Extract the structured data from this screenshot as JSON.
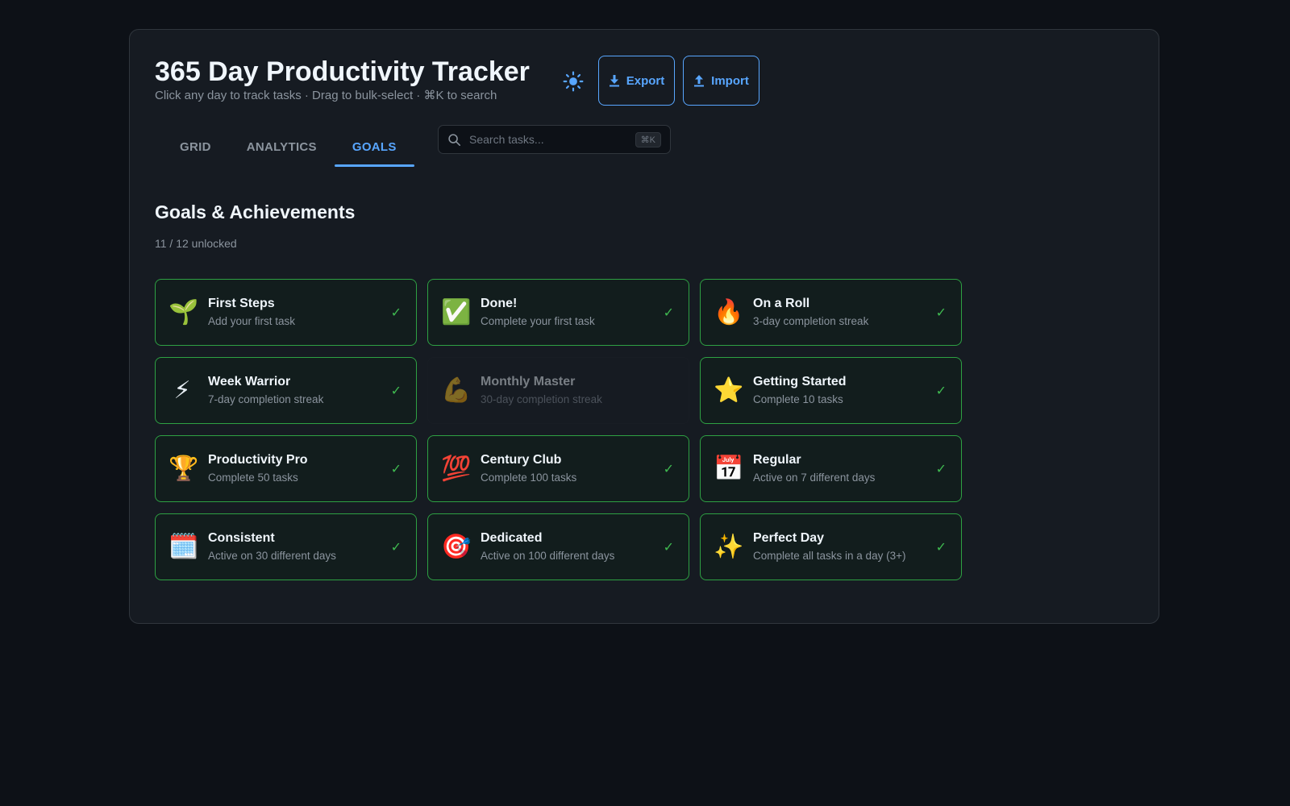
{
  "header": {
    "title": "365 Day Productivity Tracker",
    "subtitle": "Click any day to track tasks · Drag to bulk-select · ⌘K to search",
    "theme_icon": "sun-icon",
    "export_label": "Export",
    "import_label": "Import"
  },
  "tabs": [
    {
      "label": "GRID",
      "active": false
    },
    {
      "label": "ANALYTICS",
      "active": false
    },
    {
      "label": "GOALS",
      "active": true
    }
  ],
  "search": {
    "placeholder": "Search tasks...",
    "value": "",
    "shortcut": "⌘K"
  },
  "goals": {
    "title": "Goals & Achievements",
    "progress": "11 / 12 unlocked",
    "achievements": [
      {
        "icon": "🌱",
        "icon_name": "seedling-icon",
        "name": "First Steps",
        "desc": "Add your first task",
        "unlocked": true
      },
      {
        "icon": "✅",
        "icon_name": "check-mark-button-icon",
        "name": "Done!",
        "desc": "Complete your first task",
        "unlocked": true
      },
      {
        "icon": "🔥",
        "icon_name": "fire-icon",
        "name": "On a Roll",
        "desc": "3-day completion streak",
        "unlocked": true
      },
      {
        "icon": "⚡",
        "icon_name": "lightning-icon",
        "name": "Week Warrior",
        "desc": "7-day completion streak",
        "unlocked": true
      },
      {
        "icon": "💪",
        "icon_name": "flexed-biceps-icon",
        "name": "Monthly Master",
        "desc": "30-day completion streak",
        "unlocked": false
      },
      {
        "icon": "⭐",
        "icon_name": "star-icon",
        "name": "Getting Started",
        "desc": "Complete 10 tasks",
        "unlocked": true
      },
      {
        "icon": "🏆",
        "icon_name": "trophy-icon",
        "name": "Productivity Pro",
        "desc": "Complete 50 tasks",
        "unlocked": true
      },
      {
        "icon": "💯",
        "icon_name": "hundred-points-icon",
        "name": "Century Club",
        "desc": "Complete 100 tasks",
        "unlocked": true
      },
      {
        "icon": "📅",
        "icon_name": "calendar-icon",
        "name": "Regular",
        "desc": "Active on 7 different days",
        "unlocked": true
      },
      {
        "icon": "🗓️",
        "icon_name": "spiral-calendar-icon",
        "name": "Consistent",
        "desc": "Active on 30 different days",
        "unlocked": true
      },
      {
        "icon": "🎯",
        "icon_name": "target-icon",
        "name": "Dedicated",
        "desc": "Active on 100 different days",
        "unlocked": true
      },
      {
        "icon": "✨",
        "icon_name": "sparkles-icon",
        "name": "Perfect Day",
        "desc": "Complete all tasks in a day (3+)",
        "unlocked": true
      }
    ],
    "check_symbol": "✓"
  },
  "colors": {
    "accent": "#58a6ff",
    "success": "#3fb950",
    "background": "#0d1117",
    "panel": "#161b22"
  }
}
